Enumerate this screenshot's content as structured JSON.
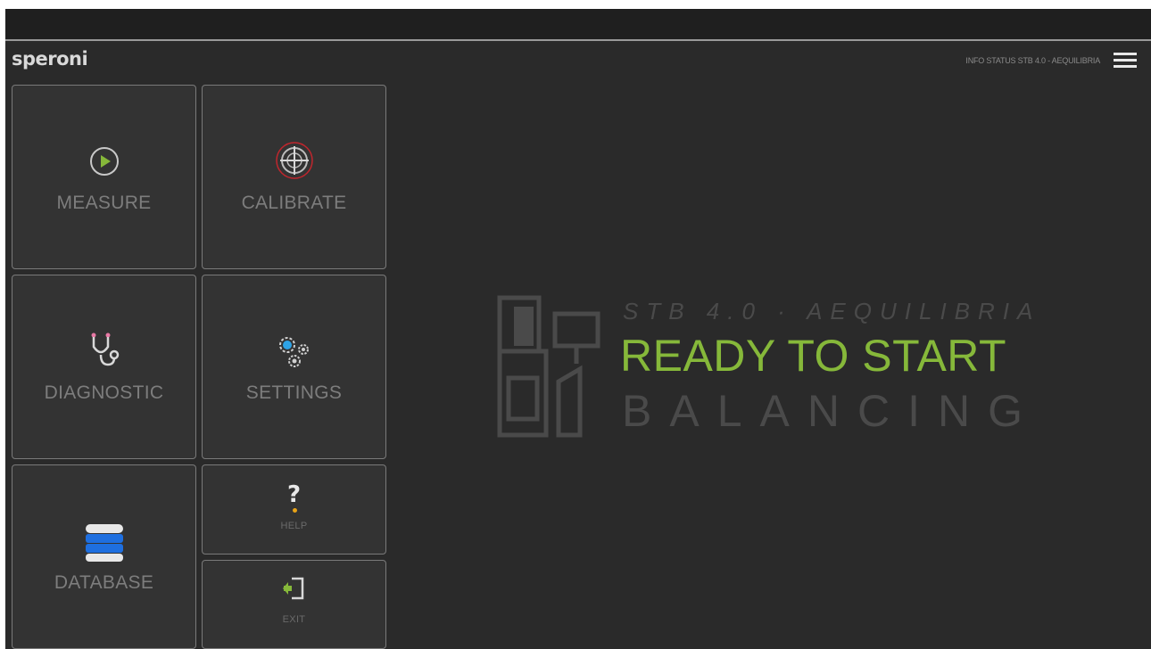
{
  "header": {
    "brand": "speroni",
    "info_status": "INFO STATUS STB 4.0 - AEQUILIBRIA",
    "menu_icon": "hamburger-menu-icon"
  },
  "tiles": {
    "measure": {
      "label": "MEASURE",
      "icon": "play-circle-icon"
    },
    "calibrate": {
      "label": "CALIBRATE",
      "icon": "crosshair-target-icon"
    },
    "diagnostic": {
      "label": "DIAGNOSTIC",
      "icon": "stethoscope-icon"
    },
    "settings": {
      "label": "SETTINGS",
      "icon": "gears-icon"
    },
    "database": {
      "label": "DATABASE",
      "icon": "database-icon"
    },
    "help": {
      "label": "HELP",
      "icon_glyph": "?",
      "icon": "question-mark-icon"
    },
    "exit": {
      "label": "EXIT",
      "icon": "exit-door-icon"
    }
  },
  "hero": {
    "model": "STB 4.0 · AEQUILIBRIA",
    "status_line": "READY TO START",
    "subtitle": "BALANCING",
    "machine_icon": "balancing-machine-icon"
  },
  "colors": {
    "background": "#2a2a2a",
    "tile": "#333333",
    "accent_green": "#86b83a",
    "accent_blue": "#1e6fe0",
    "accent_red": "#c0262d",
    "accent_yellow": "#e8a317"
  }
}
